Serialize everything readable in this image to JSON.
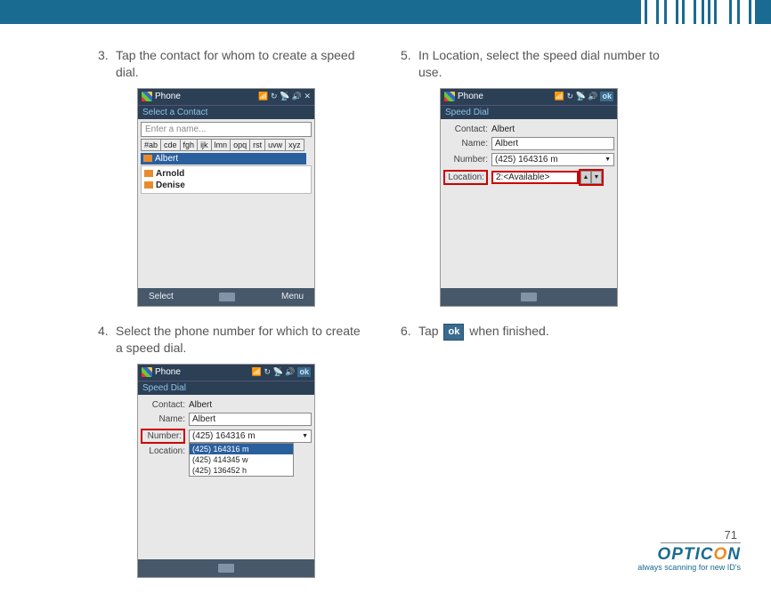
{
  "steps": {
    "s3": {
      "num": "3.",
      "text": "Tap the contact for whom to create a speed dial."
    },
    "s4": {
      "num": "4.",
      "text": "Select the phone number for which to create a speed dial."
    },
    "s5": {
      "num": "5.",
      "text": "In Location, select the speed dial number to use."
    },
    "s6": {
      "num": "6.",
      "text_before": "Tap ",
      "ok": "ok",
      "text_after": " when finished."
    }
  },
  "shot1": {
    "title": "Phone",
    "placeholder": "Enter a name...",
    "tabs": [
      "#ab",
      "cde",
      "fgh",
      "ijk",
      "lmn",
      "opq",
      "rst",
      "uvw",
      "xyz"
    ],
    "highlight": "Albert",
    "contacts": [
      "Arnold",
      "Denise"
    ],
    "foot_left": "Select",
    "foot_right": "Menu"
  },
  "shot2": {
    "title": "Phone",
    "sub": "Speed Dial",
    "contact_lbl": "Contact:",
    "contact_val": "Albert",
    "name_lbl": "Name:",
    "name_val": "Albert",
    "number_lbl": "Number:",
    "number_val": "(425) 164316 m",
    "location_lbl": "Location:",
    "dd_sel": "(425) 164316 m",
    "dd_items": [
      "(425) 414345 w",
      "(425) 136452 h"
    ],
    "ok": "ok"
  },
  "shot3": {
    "title": "Phone",
    "sub": "Speed Dial",
    "contact_lbl": "Contact:",
    "contact_val": "Albert",
    "name_lbl": "Name:",
    "name_val": "Albert",
    "number_lbl": "Number:",
    "number_val": "(425) 164316 m",
    "location_lbl": "Location:",
    "location_val": "2:<Available>",
    "ok": "ok"
  },
  "page": "71",
  "brand": {
    "logo_a": "OPTIC",
    "logo_dash": "-",
    "logo_b": "ON",
    "tag": "always scanning for new ID's"
  }
}
